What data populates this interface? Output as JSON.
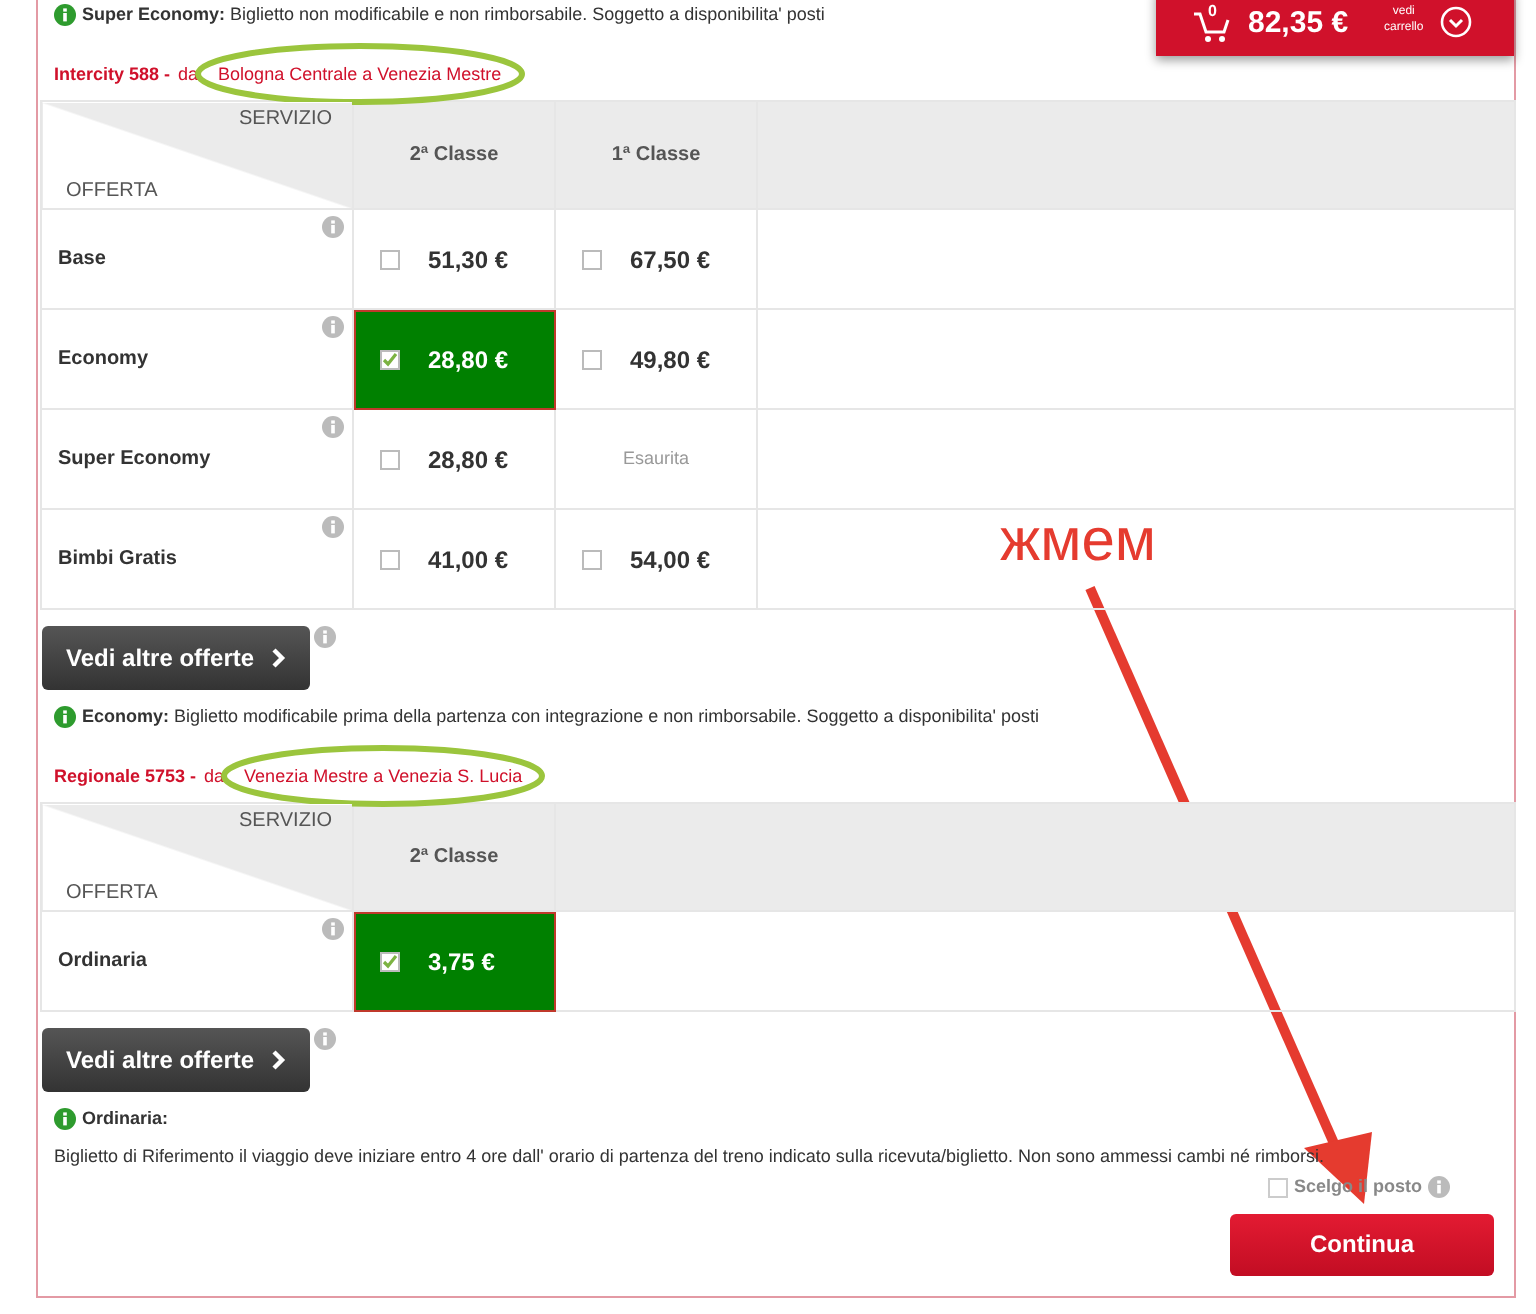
{
  "top_note": {
    "title": "Super Economy:",
    "text": "Biglietto non modificabile e non rimborsabile. Soggetto a disponibilita' posti"
  },
  "cart": {
    "count": "0",
    "total": "82,35 €",
    "link_line1": "vedi",
    "link_line2": "carrello"
  },
  "trains": [
    {
      "name": "Intercity  588 -",
      "from_word": "da",
      "route": "Bologna Centrale  a  Venezia Mestre",
      "header_service": "SERVIZIO",
      "header_offer": "OFFERTA",
      "classes": [
        "2ª Classe",
        "1ª Classe"
      ],
      "rows": [
        {
          "offer": "Base",
          "cells": [
            {
              "kind": "price",
              "price": "51,30 €",
              "checked": false
            },
            {
              "kind": "price",
              "price": "67,50 €",
              "checked": false
            }
          ]
        },
        {
          "offer": "Economy",
          "cells": [
            {
              "kind": "price",
              "price": "28,80 €",
              "checked": true
            },
            {
              "kind": "price",
              "price": "49,80 €",
              "checked": false
            }
          ]
        },
        {
          "offer": "Super Economy",
          "cells": [
            {
              "kind": "price",
              "price": "28,80 €",
              "checked": false
            },
            {
              "kind": "soldout",
              "text": "Esaurita"
            }
          ]
        },
        {
          "offer": "Bimbi Gratis",
          "cells": [
            {
              "kind": "price",
              "price": "41,00 €",
              "checked": false
            },
            {
              "kind": "price",
              "price": "54,00 €",
              "checked": false
            }
          ]
        }
      ],
      "more_button": "Vedi altre offerte",
      "note": {
        "kind": "inline",
        "title": "Economy:",
        "text": "Biglietto modificabile prima della partenza con integrazione e non rimborsabile. Soggetto a disponibilita' posti"
      }
    },
    {
      "name": "Regionale  5753 -",
      "from_word": "da",
      "route": "Venezia Mestre  a  Venezia S. Lucia",
      "header_service": "SERVIZIO",
      "header_offer": "OFFERTA",
      "classes": [
        "2ª Classe"
      ],
      "rows": [
        {
          "offer": "Ordinaria",
          "cells": [
            {
              "kind": "price",
              "price": "3,75 €",
              "checked": true
            }
          ]
        }
      ],
      "more_button": "Vedi altre offerte",
      "note": {
        "kind": "block",
        "title": "Ordinaria:",
        "text": "Biglietto di Riferimento il viaggio deve iniziare entro 4 ore dall' orario di partenza del treno indicato sulla ricevuta/biglietto. Non sono ammessi cambi né rimborsi."
      }
    }
  ],
  "seat_choice": {
    "label": "Scelgo il posto",
    "checked": false
  },
  "continue_button": "Continua",
  "annotation": {
    "label": "жмем"
  }
}
